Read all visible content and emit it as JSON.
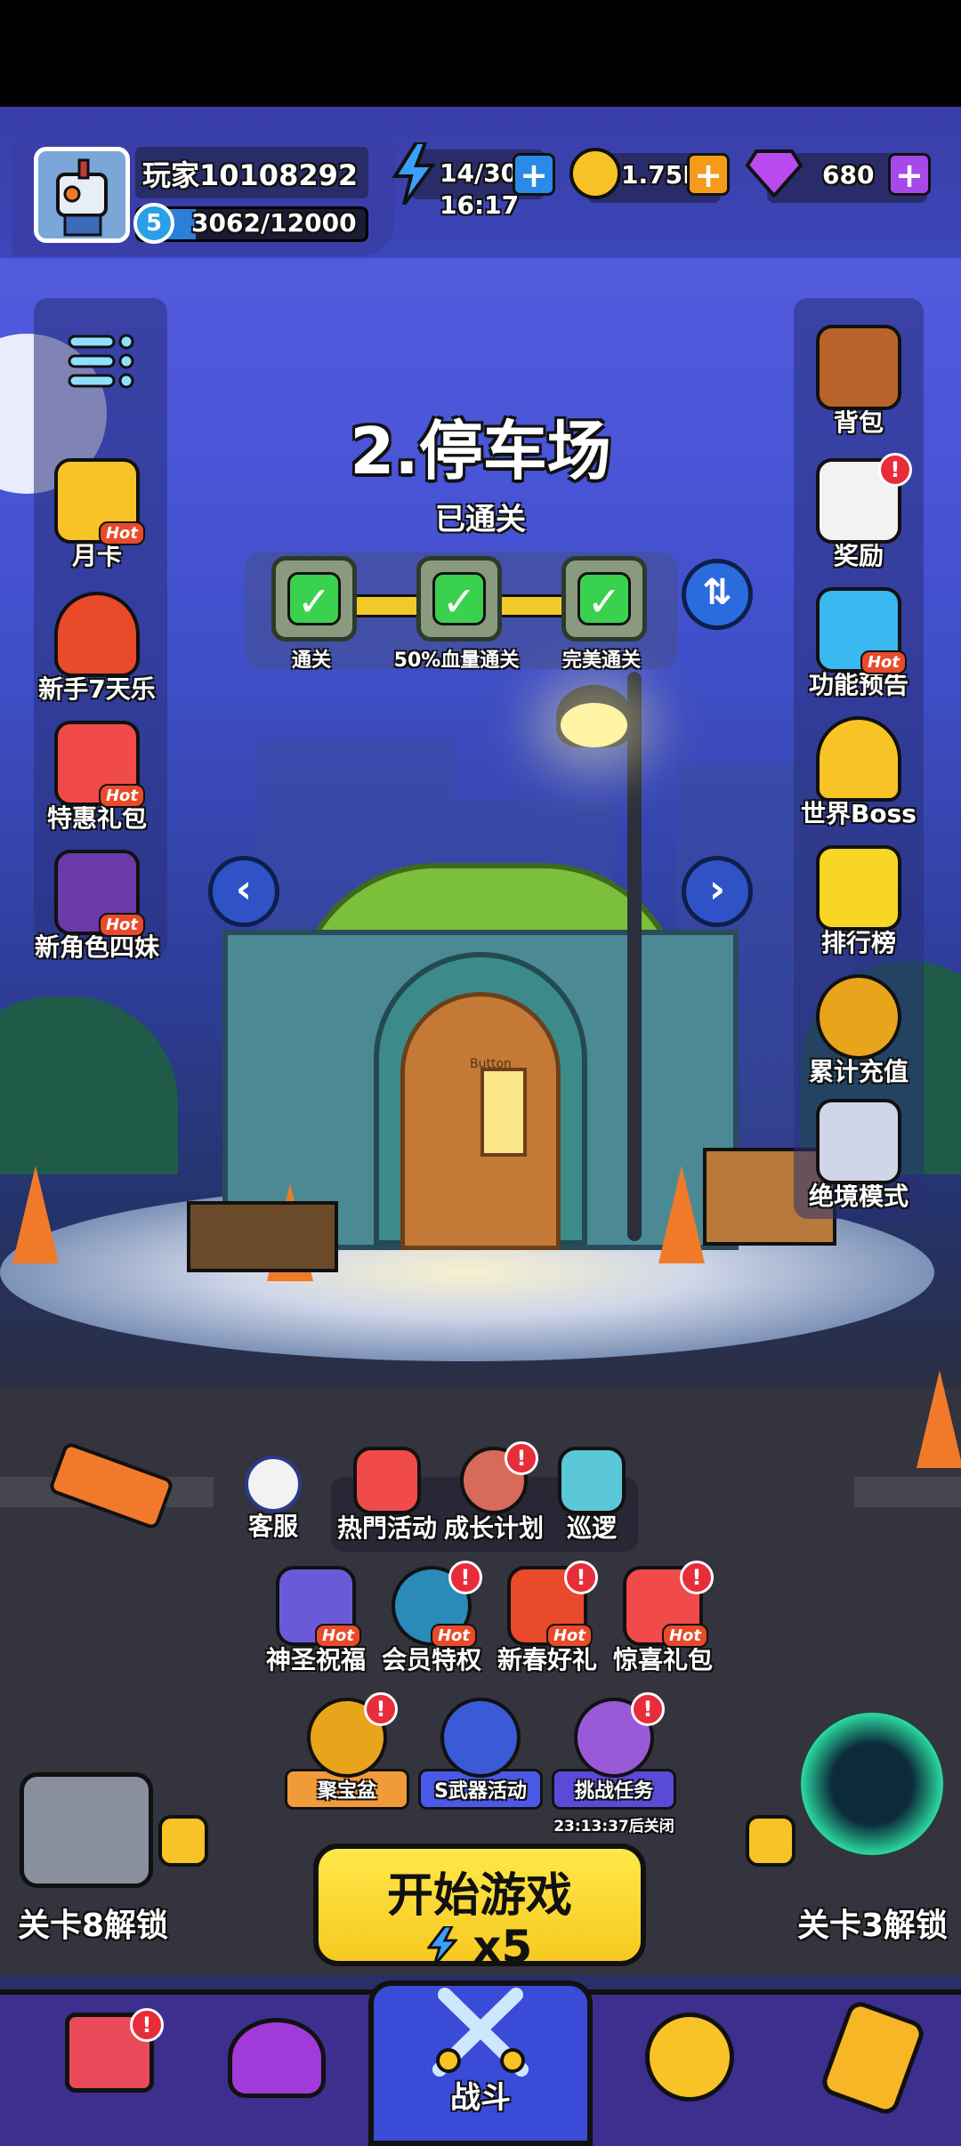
{
  "player": {
    "name": "玩家10108292",
    "level": "5",
    "xp_text": "3062/12000",
    "xp_fraction": 0.255
  },
  "resources": {
    "energy": "14/30",
    "energy_timer": "16:17",
    "coins": "1.75K",
    "gems": "680"
  },
  "colors": {
    "energy": "#3aa0ff",
    "coin": "#f7c326",
    "gem": "#b94af0",
    "plus_energy": "#2a8ae8",
    "plus_coin": "#f59a1a",
    "plus_gem": "#a54ae8"
  },
  "stage": {
    "title": "2.停车场",
    "status": "已通关",
    "stars": [
      {
        "label": "通关"
      },
      {
        "label": "50%血量通关"
      },
      {
        "label": "完美通关"
      }
    ],
    "door_text": "Button"
  },
  "left_menu": [
    {
      "label": "",
      "icon": "menu-icon"
    },
    {
      "label": "月卡",
      "icon": "crown-card-icon",
      "hot": "Hot"
    },
    {
      "label": "新手7天乐",
      "icon": "trophy-clock-icon"
    },
    {
      "label": "特惠礼包",
      "icon": "gift-icon",
      "hot": "Hot"
    },
    {
      "label": "新角色四妹",
      "icon": "character-icon",
      "hot": "Hot"
    }
  ],
  "right_menu": [
    {
      "label": "背包",
      "icon": "backpack-icon"
    },
    {
      "label": "奖励",
      "icon": "clipboard-gift-icon",
      "badge": "!"
    },
    {
      "label": "功能预告",
      "icon": "tv-icon",
      "hot": "Hot"
    },
    {
      "label": "世界Boss",
      "icon": "locked-boss-icon"
    },
    {
      "label": "排行榜",
      "icon": "podium-icon"
    },
    {
      "label": "累计充值",
      "icon": "gold-pot-icon"
    },
    {
      "label": "绝境模式",
      "icon": "skull-swords-icon"
    }
  ],
  "activities_row1": [
    {
      "label": "客服",
      "icon": "support-agent-icon"
    },
    {
      "label": "热門活动",
      "icon": "gift-box-icon"
    },
    {
      "label": "成长计划",
      "icon": "meat-icon",
      "badge": "!"
    },
    {
      "label": "巡逻",
      "icon": "map-icon"
    }
  ],
  "activities_row2": [
    {
      "label": "神圣祝福",
      "icon": "blessing-icon",
      "hot": "Hot"
    },
    {
      "label": "会员特权",
      "icon": "vip-orb-icon",
      "hot": "Hot",
      "badge": "!"
    },
    {
      "label": "新春好礼",
      "icon": "spring-gift-icon",
      "hot": "Hot",
      "badge": "!"
    },
    {
      "label": "惊喜礼包",
      "icon": "surprise-gift-icon",
      "hot": "Hot",
      "badge": "!"
    }
  ],
  "activities_row3": [
    {
      "label": "聚宝盆",
      "icon": "treasure-bowl-icon",
      "badge": "!"
    },
    {
      "label": "S武器活动",
      "icon": "weapon-orb-icon"
    },
    {
      "label": "挑战任务",
      "icon": "challenge-tent-icon",
      "badge": "!",
      "sub": "23:13:37后关闭"
    }
  ],
  "start": {
    "label": "开始游戏",
    "cost": "x5"
  },
  "locked": {
    "left": "关卡8解锁",
    "right": "关卡3解锁"
  },
  "bottom_nav": [
    {
      "label": "",
      "icon": "shop-icon",
      "badge": "!"
    },
    {
      "label": "",
      "icon": "wizard-hat-icon"
    },
    {
      "label": "战斗",
      "icon": "crossed-swords-icon"
    },
    {
      "label": "",
      "icon": "emblem-icon"
    },
    {
      "label": "",
      "icon": "scroll-icon"
    }
  ]
}
